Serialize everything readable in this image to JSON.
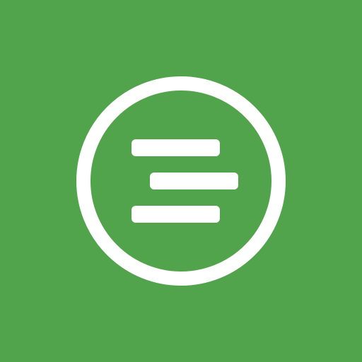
{
  "app": {
    "icon": "circled-staggered-lines-icon",
    "colors": {
      "background": "#52a44c",
      "foreground": "#ffffff"
    }
  }
}
